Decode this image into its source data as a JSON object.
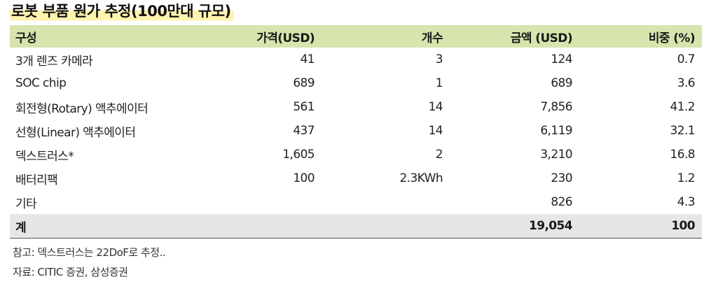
{
  "title": "로봇 부품 원가 추정(100만대 규모)",
  "table": {
    "headers": [
      "구성",
      "가격(USD)",
      "개수",
      "금액 (USD)",
      "비중 (%)"
    ],
    "rows": [
      [
        "3개 렌즈 카메라",
        "41",
        "3",
        "124",
        "0.7"
      ],
      [
        "SOC chip",
        "689",
        "1",
        "689",
        "3.6"
      ],
      [
        "회전형(Rotary) 액추에이터",
        "561",
        "14",
        "7,856",
        "41.2"
      ],
      [
        "선형(Linear) 액추에이터",
        "437",
        "14",
        "6,119",
        "32.1"
      ],
      [
        "덱스트러스*",
        "1,605",
        "2",
        "3,210",
        "16.8"
      ],
      [
        "배터리팩",
        "100",
        "2.3KWh",
        "230",
        "1.2"
      ],
      [
        "기타",
        "",
        "",
        "826",
        "4.3"
      ]
    ],
    "total": [
      "계",
      "",
      "",
      "19,054",
      "100"
    ]
  },
  "notes": [
    "참고: 덱스트러스는 22DoF로 추정..",
    "자료: CITIC 증권, 삼성증권"
  ],
  "colors": {
    "header_bg": "#d6e4ae",
    "total_bg": "#e6e6e6",
    "title_highlight": "#fff3b0"
  }
}
